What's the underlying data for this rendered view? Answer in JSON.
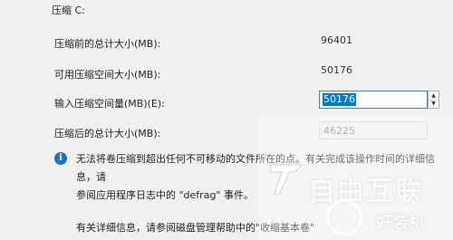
{
  "dialog": {
    "title": "压缩 C:"
  },
  "fields": [
    {
      "label": "压缩前的总计大小(MB):",
      "value": "96401"
    },
    {
      "label": "可用压缩空间大小(MB):",
      "value": "50176"
    },
    {
      "label": "输入压缩空间量(MB)(E):",
      "value": "50176"
    },
    {
      "label": "压缩后的总计大小(MB):",
      "value": "46225"
    }
  ],
  "info": {
    "line1": "无法将卷压缩到超出任何不可移动的文件所在的点。有关完成该操作时间的详细信息，请",
    "line2": "参阅应用程序日志中的 \"defrag\" 事件。"
  },
  "footer": {
    "text": "有关详细信息，请参阅磁盘管理帮助中的\"收缩基本卷\""
  },
  "watermark": {
    "brand": "自由互联",
    "sub": "好装机"
  },
  "icons": {
    "info": "info-icon",
    "spin_up": "arrow-up-icon",
    "spin_down": "arrow-down-icon"
  }
}
